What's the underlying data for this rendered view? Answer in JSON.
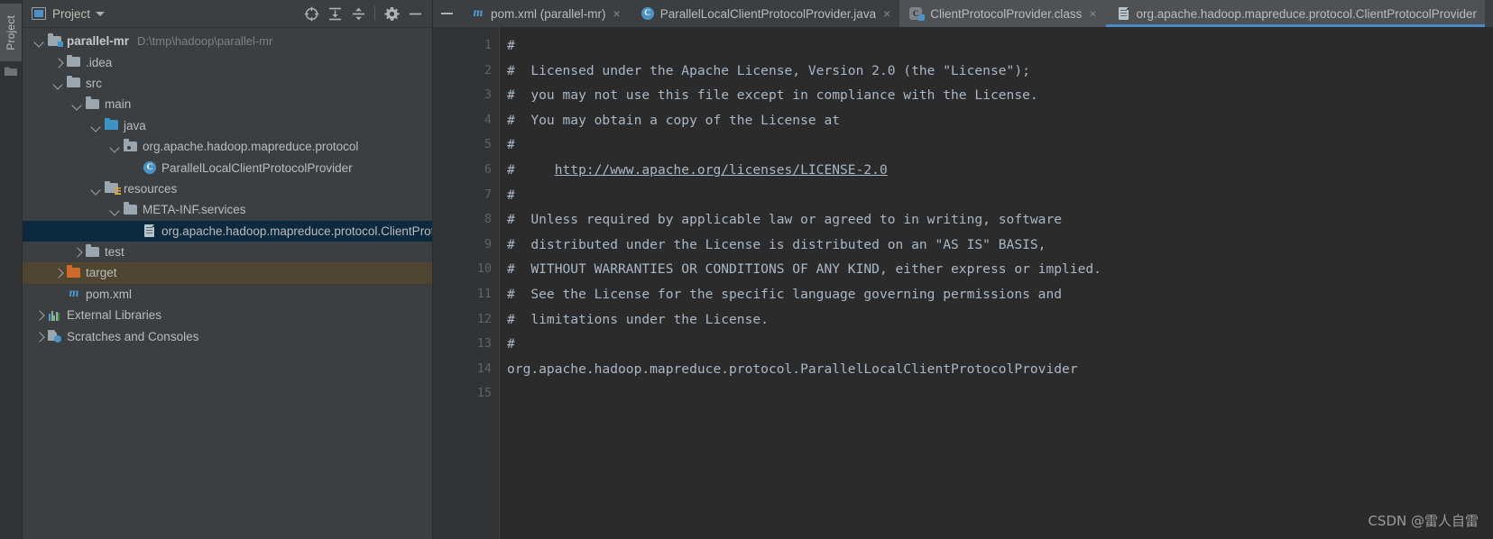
{
  "tool_strip": {
    "tab_label": "Project",
    "folder_icon": "folder-icon"
  },
  "project_panel": {
    "title": "Project",
    "toolbar": {
      "project_icon": "project-window-icon",
      "dropdown_icon": "chevron-down-icon",
      "locate_label": "",
      "buttons": [
        {
          "name": "select-opened-file-icon"
        },
        {
          "name": "expand-all-icon"
        },
        {
          "name": "collapse-all-icon"
        },
        {
          "name": "settings-gear-icon"
        },
        {
          "name": "hide-panel-icon"
        }
      ]
    },
    "tree": [
      {
        "indent": 0,
        "arrow": "expanded",
        "icon": "module-folder-icon",
        "label": "parallel-mr",
        "bold": true,
        "path": "D:\\tmp\\hadoop\\parallel-mr",
        "state": "normal"
      },
      {
        "indent": 1,
        "arrow": "collapsed",
        "icon": "folder-icon",
        "label": ".idea",
        "bold": false,
        "path": "",
        "state": "normal"
      },
      {
        "indent": 1,
        "arrow": "expanded",
        "icon": "folder-icon",
        "label": "src",
        "bold": false,
        "path": "",
        "state": "normal"
      },
      {
        "indent": 2,
        "arrow": "expanded",
        "icon": "folder-icon",
        "label": "main",
        "bold": false,
        "path": "",
        "state": "normal"
      },
      {
        "indent": 3,
        "arrow": "expanded",
        "icon": "source-folder-icon",
        "label": "java",
        "bold": false,
        "path": "",
        "state": "normal"
      },
      {
        "indent": 4,
        "arrow": "expanded",
        "icon": "package-icon",
        "label": "org.apache.hadoop.mapreduce.protocol",
        "bold": false,
        "path": "",
        "state": "normal"
      },
      {
        "indent": 5,
        "arrow": "none",
        "icon": "java-class-icon",
        "label": "ParallelLocalClientProtocolProvider",
        "bold": false,
        "path": "",
        "state": "normal"
      },
      {
        "indent": 3,
        "arrow": "expanded",
        "icon": "resources-folder-icon",
        "label": "resources",
        "bold": false,
        "path": "",
        "state": "normal"
      },
      {
        "indent": 4,
        "arrow": "expanded",
        "icon": "folder-icon",
        "label": "META-INF.services",
        "bold": false,
        "path": "",
        "state": "normal"
      },
      {
        "indent": 5,
        "arrow": "none",
        "icon": "text-file-icon",
        "label": "org.apache.hadoop.mapreduce.protocol.ClientProtocolProvider",
        "bold": false,
        "path": "",
        "state": "selected"
      },
      {
        "indent": 2,
        "arrow": "collapsed",
        "icon": "folder-icon",
        "label": "test",
        "bold": false,
        "path": "",
        "state": "normal"
      },
      {
        "indent": 1,
        "arrow": "collapsed",
        "icon": "excluded-folder-icon",
        "label": "target",
        "bold": false,
        "path": "",
        "state": "highlight"
      },
      {
        "indent": 1,
        "arrow": "none",
        "icon": "maven-file-icon",
        "label": "pom.xml",
        "bold": false,
        "path": "",
        "state": "normal"
      },
      {
        "indent": 0,
        "arrow": "collapsed",
        "icon": "external-libraries-icon",
        "label": "External Libraries",
        "bold": false,
        "path": "",
        "state": "normal"
      },
      {
        "indent": 0,
        "arrow": "collapsed",
        "icon": "scratches-icon",
        "label": "Scratches and Consoles",
        "bold": false,
        "path": "",
        "state": "normal"
      }
    ]
  },
  "editor": {
    "minimize_icon": "minimize-icon",
    "tabs": [
      {
        "icon": "maven-file-icon",
        "label": "pom.xml (parallel-mr)",
        "close": "×",
        "active": false,
        "dark": false
      },
      {
        "icon": "java-class-icon",
        "label": "ParallelLocalClientProtocolProvider.java",
        "close": "×",
        "active": false,
        "dark": false
      },
      {
        "icon": "compiled-class-icon",
        "label": "ClientProtocolProvider.class",
        "close": "×",
        "active": false,
        "dark": true
      },
      {
        "icon": "text-file-icon",
        "label": "org.apache.hadoop.mapreduce.protocol.ClientProtocolProvider",
        "close": "",
        "active": true,
        "dark": true
      }
    ],
    "line_numbers": [
      "1",
      "2",
      "3",
      "4",
      "5",
      "6",
      "7",
      "8",
      "9",
      "10",
      "11",
      "12",
      "13",
      "14",
      "15"
    ],
    "lines": [
      {
        "text": "#",
        "link": ""
      },
      {
        "text": "#  Licensed under the Apache License, Version 2.0 (the \"License\");",
        "link": ""
      },
      {
        "text": "#  you may not use this file except in compliance with the License.",
        "link": ""
      },
      {
        "text": "#  You may obtain a copy of the License at",
        "link": ""
      },
      {
        "text": "#",
        "link": ""
      },
      {
        "text": "#     ",
        "link": "http://www.apache.org/licenses/LICENSE-2.0"
      },
      {
        "text": "#",
        "link": ""
      },
      {
        "text": "#  Unless required by applicable law or agreed to in writing, software",
        "link": ""
      },
      {
        "text": "#  distributed under the License is distributed on an \"AS IS\" BASIS,",
        "link": ""
      },
      {
        "text": "#  WITHOUT WARRANTIES OR CONDITIONS OF ANY KIND, either express or implied.",
        "link": ""
      },
      {
        "text": "#  See the License for the specific language governing permissions and",
        "link": ""
      },
      {
        "text": "#  limitations under the License.",
        "link": ""
      },
      {
        "text": "#",
        "link": ""
      },
      {
        "text": "org.apache.hadoop.mapreduce.protocol.ParallelLocalClientProtocolProvider",
        "link": ""
      },
      {
        "text": "",
        "link": ""
      }
    ]
  },
  "watermark": "CSDN @雷人自雷",
  "colors": {
    "panel_bg": "#3c3f41",
    "editor_bg": "#2b2b2b",
    "gutter_bg": "#313335",
    "selection": "#0d293e",
    "highlight": "#4e4631",
    "accent_blue": "#4a88c7",
    "text": "#bbbbbb",
    "code_text": "#a9b7c6"
  }
}
